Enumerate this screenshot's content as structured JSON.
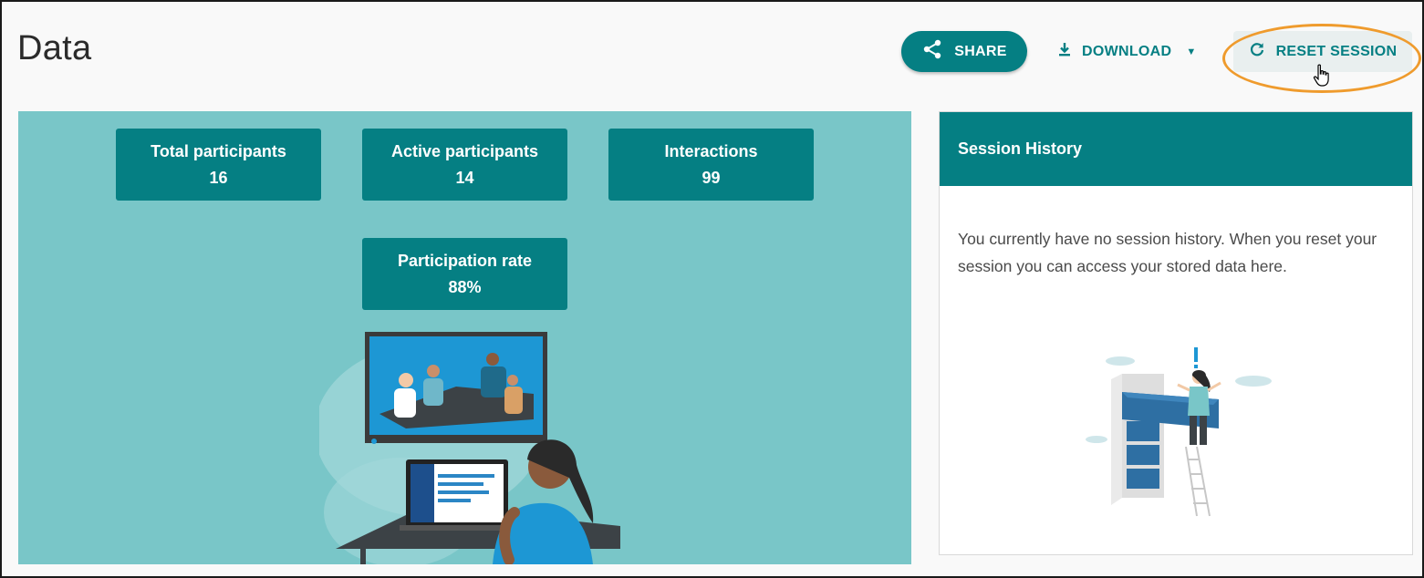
{
  "page": {
    "title": "Data"
  },
  "toolbar": {
    "share_label": "SHARE",
    "download_label": "DOWNLOAD",
    "reset_label": "RESET SESSION"
  },
  "stats": [
    {
      "label": "Total participants",
      "value": "16"
    },
    {
      "label": "Active participants",
      "value": "14"
    },
    {
      "label": "Interactions",
      "value": "99"
    },
    {
      "label": "Participation rate",
      "value": "88%"
    }
  ],
  "session_history": {
    "title": "Session History",
    "empty_message": "You currently have no session history. When you reset your session you can access your stored data here."
  },
  "colors": {
    "accent": "#057f83",
    "panel_bg": "#79c6c8",
    "highlight": "#ef9b2d"
  },
  "icons": [
    "share-icon",
    "download-icon",
    "chevron-down-icon",
    "refresh-icon",
    "hand-cursor-icon"
  ]
}
